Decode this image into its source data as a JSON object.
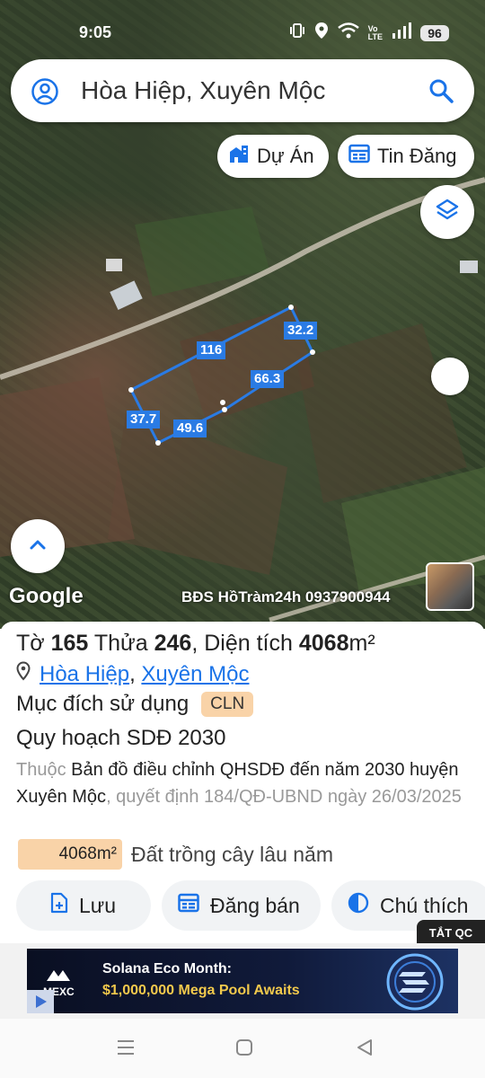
{
  "status_bar": {
    "time": "9:05",
    "battery": "96"
  },
  "search": {
    "text": "Hòa Hiệp, Xuyên Mộc"
  },
  "chips": {
    "du_an": "Dự Án",
    "tin_dang": "Tin Đăng"
  },
  "map": {
    "edge_labels": [
      "116",
      "32.2",
      "66.3",
      "37.7",
      "49.6"
    ],
    "google_logo": "Google",
    "watermark": "BĐS HồTràm24h 0937900944",
    "plot_outline_color": "#2a7be4"
  },
  "parcel": {
    "to_label": "Tờ",
    "to_number": "165",
    "thua_label": "Thửa",
    "thua_number": "246",
    "area_label": "Diện tích",
    "area_value": "4068",
    "area_unit": "m²",
    "ward": "Hòa Hiệp",
    "district": "Xuyên Mộc",
    "purpose_label": "Mục đích sử dụng",
    "purpose_code": "CLN",
    "plan_title": "Quy hoạch SDĐ 2030",
    "plan_prefix": "Thuộc",
    "plan_name": "Bản đồ điều chỉnh QHSDĐ đến năm 2030 huyện Xuyên Mộc",
    "plan_decision": ", quyết định 184/QĐ-UBND ngày 26/03/2025",
    "land_area_badge": "4068m²",
    "land_type": "Đất trồng cây lâu năm"
  },
  "actions": {
    "save": "Lưu",
    "post_sale": "Đăng bán",
    "legend": "Chú thích"
  },
  "ad": {
    "close_label": "TẮT QC",
    "brand": "MEXC",
    "headline": "Solana Eco Month:",
    "subline": "$1,000,000 Mega Pool Awaits"
  },
  "colors": {
    "accent": "#1a73e8",
    "badge": "#f9d3a8"
  }
}
